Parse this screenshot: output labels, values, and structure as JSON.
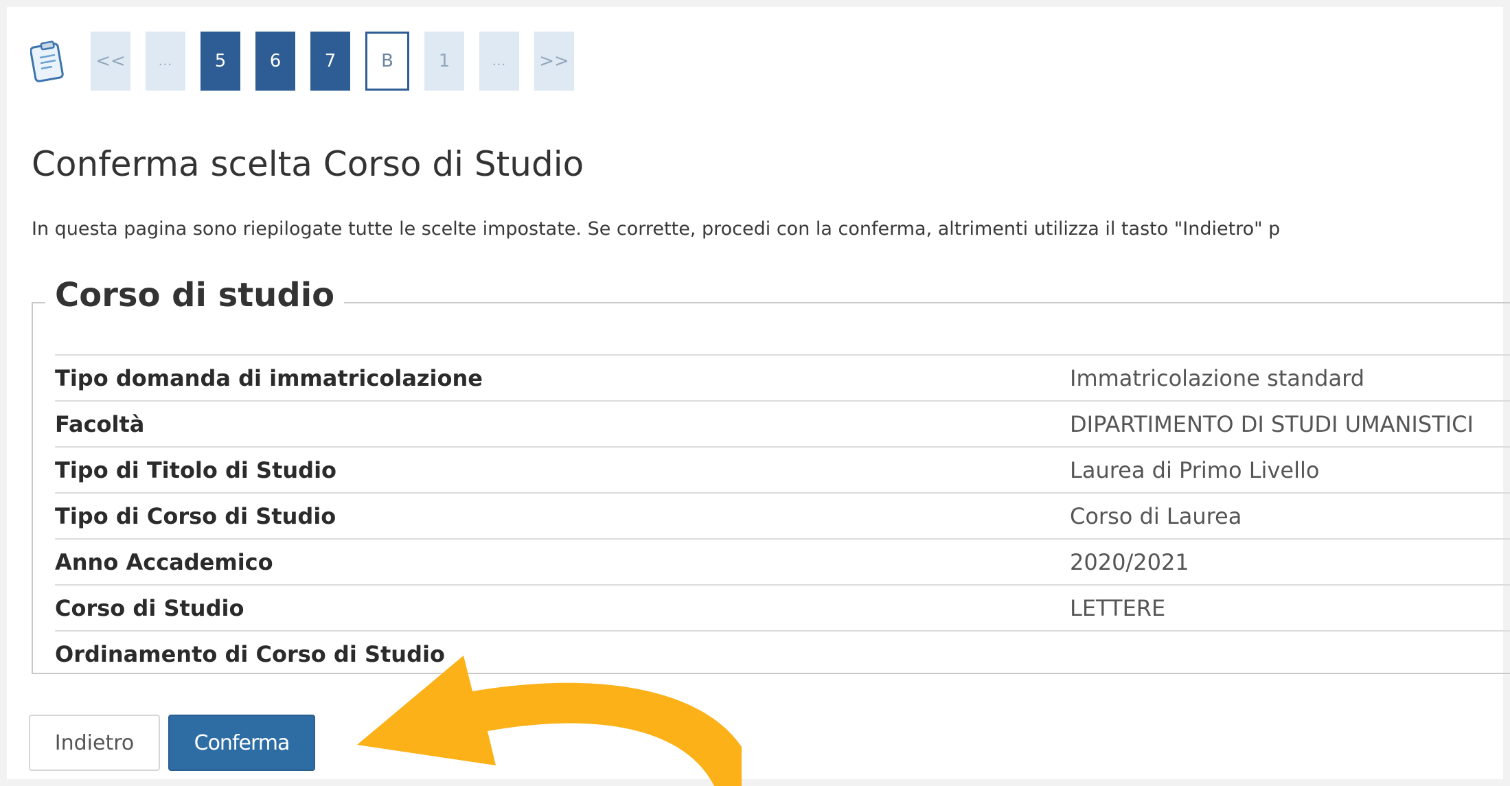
{
  "pager": {
    "icon": "clipboard-icon",
    "items": [
      {
        "label": "<<",
        "style": "light"
      },
      {
        "label": "...",
        "style": "light"
      },
      {
        "label": "5",
        "style": "dark"
      },
      {
        "label": "6",
        "style": "dark"
      },
      {
        "label": "7",
        "style": "dark"
      },
      {
        "label": "B",
        "style": "current"
      },
      {
        "label": "1",
        "style": "light"
      },
      {
        "label": "...",
        "style": "light"
      },
      {
        "label": ">>",
        "style": "light"
      }
    ]
  },
  "page": {
    "title": "Conferma scelta Corso di Studio",
    "intro": "In questa pagina sono riepilogate tutte le scelte impostate. Se corrette, procedi con la conferma, altrimenti utilizza il tasto \"Indietro\" p"
  },
  "section": {
    "legend": "Corso di studio",
    "rows": [
      {
        "label": "Tipo domanda di immatricolazione",
        "value": "Immatricolazione standard"
      },
      {
        "label": "Facoltà",
        "value": "DIPARTIMENTO DI STUDI UMANISTICI"
      },
      {
        "label": "Tipo di Titolo di Studio",
        "value": "Laurea di Primo Livello"
      },
      {
        "label": "Tipo di Corso di Studio",
        "value": "Corso di Laurea"
      },
      {
        "label": "Anno Accademico",
        "value": "2020/2021"
      },
      {
        "label": "Corso di Studio",
        "value": "LETTERE"
      },
      {
        "label": "Ordinamento di Corso di Studio",
        "value": ""
      }
    ]
  },
  "buttons": {
    "back_label": "Indietro",
    "confirm_label": "Conferma"
  },
  "colors": {
    "accent": "#2e6da4",
    "pager_dark": "#2d5d94",
    "pager_light": "#dfe9f3",
    "annotation_arrow": "#fbb117"
  }
}
